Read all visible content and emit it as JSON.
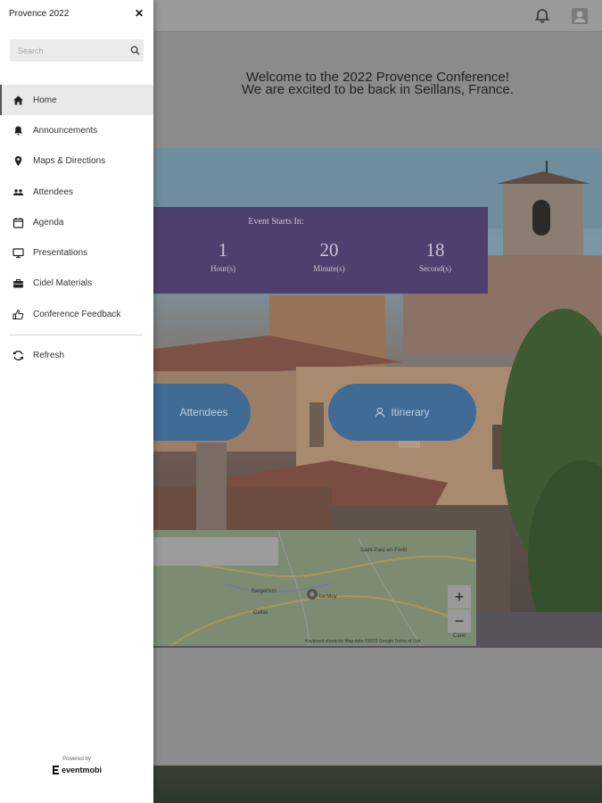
{
  "app": {
    "title": "Provence 2022"
  },
  "search": {
    "placeholder": "Search"
  },
  "nav": {
    "items": [
      {
        "label": "Home",
        "icon": "home-icon",
        "active": true
      },
      {
        "label": "Announcements",
        "icon": "bell-icon"
      },
      {
        "label": "Maps & Directions",
        "icon": "map-pin-icon"
      },
      {
        "label": "Attendees",
        "icon": "people-icon"
      },
      {
        "label": "Agenda",
        "icon": "calendar-icon"
      },
      {
        "label": "Presentations",
        "icon": "monitor-icon"
      },
      {
        "label": "Cidel Materials",
        "icon": "briefcase-icon"
      },
      {
        "label": "Conference Feedback",
        "icon": "thumbs-up-icon"
      }
    ],
    "refresh_label": "Refresh"
  },
  "footer": {
    "powered_by": "Powered by",
    "brand": "eventmobi"
  },
  "welcome": {
    "line1": "Welcome to the 2022 Provence Conference!",
    "line2": "We are excited to be back in Seillans, France."
  },
  "countdown": {
    "title": "Event Starts In:",
    "hours": "1",
    "hours_label": "Hour(s)",
    "minutes": "20",
    "minutes_label": "Minute(s)",
    "seconds": "18",
    "seconds_label": "Second(s)"
  },
  "buttons": {
    "attendees": "Attendees",
    "itinerary": "Itinerary"
  },
  "map": {
    "zoom_in": "+",
    "zoom_out": "−",
    "footer": "Keyboard shortcuts   Map data ©2022 Google   Terms of Use",
    "places": [
      "Saint-Paul-en-Forêt",
      "Bargemon",
      "Callas",
      "Le Muy",
      "Cann"
    ]
  },
  "colors": {
    "countdown_bg": "#4e3f6e",
    "button_bg": "#3f6b94",
    "drawer_bg": "#ffffff",
    "overlay": "#8f8f8f"
  }
}
